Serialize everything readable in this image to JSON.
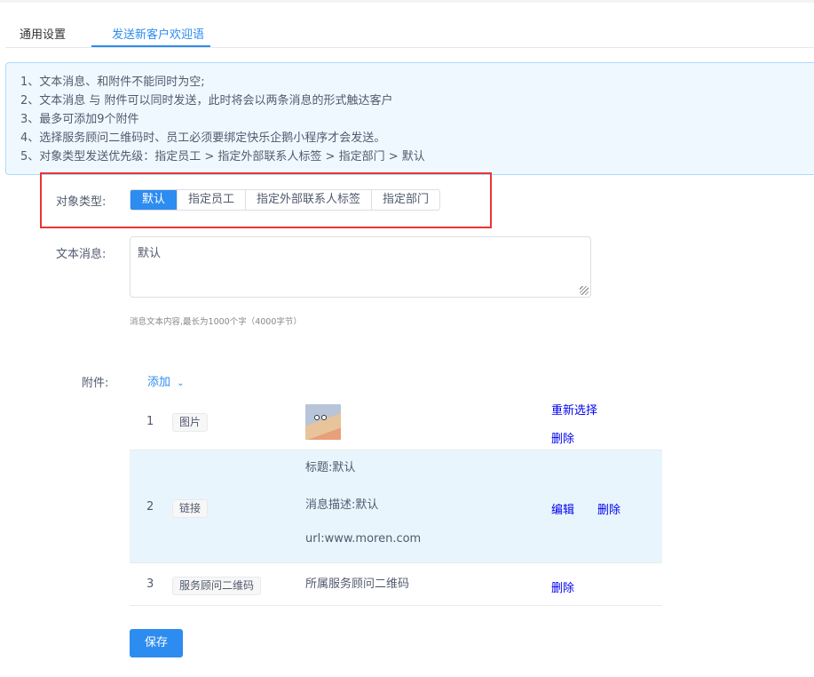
{
  "tabs": [
    {
      "label": "通用设置"
    },
    {
      "label": "发送新客户欢迎语",
      "active": true
    }
  ],
  "notice": [
    "1、文本消息、和附件不能同时为空;",
    "2、文本消息 与 附件可以同时发送，此时将会以两条消息的形式触达客户",
    "3、最多可添加9个附件",
    "4、选择服务顾问二维码时、员工必须要绑定快乐企鹅小程序才会发送。",
    "5、对象类型发送优先级：指定员工 > 指定外部联系人标签 > 指定部门 > 默认"
  ],
  "target_type": {
    "label": "对象类型:",
    "options": [
      "默认",
      "指定员工",
      "指定外部联系人标签",
      "指定部门"
    ],
    "selected": "默认"
  },
  "text_message": {
    "label": "文本消息:",
    "value": "默认",
    "hint": "消息文本内容,最长为1000个字（4000字节）"
  },
  "attachments": {
    "label": "附件:",
    "add_label": "添加",
    "rows": [
      {
        "index": "1",
        "type": "图片",
        "actions": [
          "重新选择",
          "删除"
        ]
      },
      {
        "index": "2",
        "type": "链接",
        "title": "标题:默认",
        "desc": "消息描述:默认",
        "url": "url:www.moren.com",
        "actions": [
          "编辑",
          "删除"
        ]
      },
      {
        "index": "3",
        "type": "服务顾问二维码",
        "content": "所属服务顾问二维码",
        "actions": [
          "删除"
        ]
      }
    ]
  },
  "save_label": "保存",
  "colors": {
    "primary": "#2d8cf0",
    "highlight": "#e33",
    "row_highlight": "#e8f5fd"
  }
}
